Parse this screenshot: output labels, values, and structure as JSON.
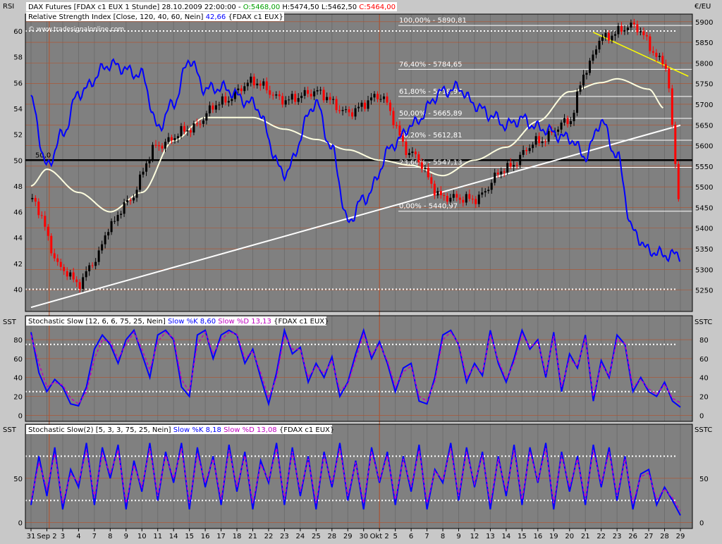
{
  "header": {
    "title_prefix": "DAX Futures [FDAX c1 EUX  1 Stunde] 28.10.2009 22:00:00 - ",
    "o": "O:5468,00",
    "h": "H:5474,50",
    "l": "L:5462,50",
    "c": "C:5464,00",
    "rsi_label": "Relative Strength Index [Close, 120, 40, 60, Nein]",
    "rsi_value": "42,66",
    "rsi_suffix": "{FDAX c1 EUX}",
    "watermark": "© www.tradesignalonline.com"
  },
  "panels": {
    "main": {
      "left_label": "RSI",
      "right_label": "€/EU"
    },
    "stoch1": {
      "left_label": "SST",
      "right_label": "SSTC",
      "title": "Stochastic Slow [12, 6, 6, 75, 25, Nein]",
      "k_label": "Slow %K 8,60",
      "d_label": "Slow %D 13,13",
      "suffix": "{FDAX c1 EUX}"
    },
    "stoch2": {
      "left_label": "SST",
      "right_label": "SSTC",
      "title": "Stochastic Slow(2) [5, 3, 3, 75, 25, Nein]",
      "k_label": "Slow %K 8,18",
      "d_label": "Slow %D 13,08",
      "suffix": "{FDAX c1 EUX}"
    }
  },
  "colors": {
    "plot_bg": "#808080",
    "frame_bg": "#c8c8c8",
    "up_candle": "#000000",
    "down_candle": "#ff0000",
    "rsi": "#0000ff",
    "moving_average": "#ffffe0",
    "trendline_up": "#ffffff",
    "trendline_down": "#ffff00",
    "fib": "#ffffff",
    "grid": "#b4502a",
    "stoch_k": "#0000ff",
    "stoch_d": "#c000c0",
    "o_color": "#00a000",
    "h_color": "#000000",
    "l_color": "#000000",
    "c_color": "#ff0000"
  },
  "chart_data": [
    {
      "type": "line",
      "panel": "main",
      "title": "DAX Futures [FDAX c1 EUX 1 Stunde] with RSI",
      "price_axis": {
        "ticks": [
          5250,
          5300,
          5350,
          5400,
          5450,
          5500,
          5550,
          5600,
          5650,
          5700,
          5750,
          5800,
          5850,
          5900
        ],
        "ylim": [
          5205,
          5915
        ]
      },
      "rsi_axis": {
        "ticks": [
          40,
          42,
          44,
          46,
          48,
          50,
          52,
          54,
          56,
          58,
          60
        ],
        "ylim": [
          38.5,
          61.2
        ]
      },
      "x_labels": [
        "31",
        "Sep 2",
        "3",
        "4",
        "7",
        "8",
        "9",
        "10",
        "11",
        "14",
        "15",
        "16",
        "17",
        "18",
        "21",
        "22",
        "23",
        "24",
        "25",
        "28",
        "29",
        "30",
        "Okt 2",
        "5",
        "6",
        "7",
        "8",
        "9",
        "12",
        "13",
        "14",
        "15",
        "16",
        "19",
        "20",
        "21",
        "22",
        "23",
        "26",
        "27",
        "28",
        "29"
      ],
      "rsi_level_label": "50,0",
      "fibonacci": [
        {
          "label": "100,00% - 5890,81",
          "price": 5890.81
        },
        {
          "label": "76,40% - 5784,65",
          "price": 5784.65
        },
        {
          "label": "61,80% - 5718,97",
          "price": 5718.97
        },
        {
          "label": "50,00% - 5665,89",
          "price": 5665.89
        },
        {
          "label": "38,20% - 5612,81",
          "price": 5612.81
        },
        {
          "label": "23,60% - 5547,13",
          "price": 5547.13
        },
        {
          "label": "0,00% - 5440,97",
          "price": 5440.97
        }
      ],
      "price_series": {
        "name": "FDAX c1 EUX",
        "x": [
          0,
          2,
          3,
          4,
          5,
          6,
          8,
          10,
          12,
          14,
          16,
          18,
          20,
          22,
          24,
          26,
          28,
          30,
          32,
          34,
          35,
          36,
          38,
          40,
          41
        ],
        "y": [
          5470,
          5300,
          5265,
          5320,
          5405,
          5460,
          5600,
          5640,
          5705,
          5755,
          5710,
          5730,
          5680,
          5720,
          5580,
          5475,
          5470,
          5545,
          5610,
          5660,
          5780,
          5860,
          5890,
          5800,
          5470
        ]
      },
      "rsi_series": {
        "name": "RSI",
        "x": [
          0,
          1,
          2,
          3,
          5,
          7,
          8,
          9,
          10,
          11,
          12,
          14,
          16,
          18,
          19,
          20,
          21,
          23,
          24,
          26,
          27,
          28,
          29,
          30,
          31,
          32,
          34,
          35,
          36,
          37,
          38,
          39,
          40,
          41
        ],
        "y": [
          54.6,
          49.5,
          52.0,
          55.2,
          57.4,
          56.6,
          52.5,
          54.4,
          57.8,
          55.5,
          55.6,
          54.4,
          49.0,
          54.4,
          50.8,
          45.2,
          47.0,
          51.3,
          52.7,
          55.3,
          55.6,
          54.3,
          53.5,
          52.7,
          53.2,
          52.5,
          51.7,
          50.3,
          53.0,
          50.3,
          44.5,
          43.0,
          42.66,
          42.66
        ]
      },
      "moving_average_series": {
        "x": [
          0,
          1,
          3,
          5,
          7,
          9,
          11,
          14,
          16,
          18,
          20,
          22,
          24,
          26,
          28,
          30,
          32,
          34,
          36,
          37,
          39,
          40
        ],
        "y": [
          48.0,
          49.3,
          47.5,
          46.0,
          47.5,
          51.5,
          53.3,
          53.3,
          52.4,
          51.6,
          50.8,
          50.0,
          49.6,
          48.8,
          50.0,
          51.0,
          53.0,
          55.3,
          56.0,
          56.3,
          55.5,
          54.0
        ]
      },
      "trendlines": [
        {
          "color": "trendline_up",
          "from": {
            "x": 0,
            "rsi": 38.6
          },
          "to": {
            "x": 41,
            "rsi": 52.7
          }
        },
        {
          "color": "trendline_down",
          "from": {
            "x": 35.5,
            "rsi": 59.9
          },
          "to": {
            "x": 41.5,
            "rsi": 56.5
          }
        }
      ]
    },
    {
      "type": "line",
      "panel": "stoch1",
      "title": "Stochastic Slow [12, 6, 6, 75, 25, Nein]",
      "y_ticks": [
        0,
        20,
        40,
        60,
        80
      ],
      "levels": [
        75,
        25
      ],
      "ylim": [
        -5,
        95
      ],
      "series": [
        {
          "name": "Slow %K",
          "color": "stoch_k",
          "x": [
            0,
            0.5,
            1,
            1.5,
            2,
            2.5,
            3,
            3.5,
            4,
            4.5,
            5,
            5.5,
            6,
            6.5,
            7,
            7.5,
            8,
            8.5,
            9,
            9.5,
            10,
            10.5,
            11,
            11.5,
            12,
            12.5,
            13,
            13.5,
            14,
            14.5,
            15,
            15.5,
            16,
            16.5,
            17,
            17.5,
            18,
            18.5,
            19,
            19.5,
            20,
            20.5,
            21,
            21.5,
            22,
            22.5,
            23,
            23.5,
            24,
            24.5,
            25,
            25.5,
            26,
            26.5,
            27,
            27.5,
            28,
            28.5,
            29,
            29.5,
            30,
            30.5,
            31,
            31.5,
            32,
            32.5,
            33,
            33.5,
            34,
            34.5,
            35,
            35.5,
            36,
            36.5,
            37,
            37.5,
            38,
            38.5,
            39,
            39.5,
            40,
            40.5,
            41
          ],
          "y": [
            88,
            45,
            25,
            38,
            30,
            12,
            10,
            30,
            70,
            85,
            75,
            55,
            80,
            90,
            65,
            40,
            85,
            90,
            80,
            30,
            20,
            85,
            90,
            60,
            85,
            90,
            85,
            55,
            70,
            40,
            12,
            45,
            90,
            65,
            72,
            35,
            55,
            40,
            62,
            20,
            35,
            65,
            90,
            60,
            78,
            55,
            25,
            50,
            55,
            15,
            12,
            40,
            85,
            90,
            75,
            35,
            55,
            42,
            90,
            55,
            35,
            60,
            90,
            70,
            80,
            40,
            88,
            25,
            65,
            50,
            85,
            15,
            58,
            40,
            85,
            75,
            25,
            40,
            25,
            20,
            35,
            15,
            8.6
          ]
        },
        {
          "name": "Slow %D",
          "color": "stoch_d",
          "x": [
            0,
            0.5,
            1,
            1.5,
            2,
            2.5,
            3,
            3.5,
            4,
            4.5,
            5,
            5.5,
            6,
            6.5,
            7,
            7.5,
            8,
            8.5,
            9,
            9.5,
            10,
            10.5,
            11,
            11.5,
            12,
            12.5,
            13,
            13.5,
            14,
            14.5,
            15,
            15.5,
            16,
            16.5,
            17,
            17.5,
            18,
            18.5,
            19,
            19.5,
            20,
            20.5,
            21,
            21.5,
            22,
            22.5,
            23,
            23.5,
            24,
            24.5,
            25,
            25.5,
            26,
            26.5,
            27,
            27.5,
            28,
            28.5,
            29,
            29.5,
            30,
            30.5,
            31,
            31.5,
            32,
            32.5,
            33,
            33.5,
            34,
            34.5,
            35,
            35.5,
            36,
            36.5,
            37,
            37.5,
            38,
            38.5,
            39,
            39.5,
            40,
            40.5,
            41
          ],
          "y": [
            85,
            55,
            30,
            35,
            32,
            18,
            12,
            25,
            60,
            80,
            78,
            60,
            75,
            88,
            70,
            48,
            78,
            88,
            82,
            38,
            25,
            75,
            88,
            65,
            80,
            88,
            86,
            60,
            68,
            45,
            18,
            40,
            85,
            70,
            70,
            40,
            52,
            44,
            58,
            26,
            33,
            60,
            86,
            64,
            75,
            58,
            30,
            46,
            52,
            20,
            15,
            36,
            80,
            88,
            76,
            40,
            52,
            45,
            86,
            58,
            38,
            56,
            86,
            72,
            78,
            44,
            84,
            30,
            60,
            52,
            82,
            20,
            54,
            42,
            80,
            76,
            30,
            38,
            28,
            22,
            33,
            18,
            13.13
          ]
        }
      ]
    },
    {
      "type": "line",
      "panel": "stoch2",
      "title": "Stochastic Slow(2) [5, 3, 3, 75, 25, Nein]",
      "y_ticks": [
        0,
        50
      ],
      "levels": [
        75,
        25
      ],
      "ylim": [
        -5,
        100
      ],
      "series": [
        {
          "name": "Slow %K",
          "color": "stoch_k",
          "x": [
            0,
            0.5,
            1,
            1.5,
            2,
            2.5,
            3,
            3.5,
            4,
            4.5,
            5,
            5.5,
            6,
            6.5,
            7,
            7.5,
            8,
            8.5,
            9,
            9.5,
            10,
            10.5,
            11,
            11.5,
            12,
            12.5,
            13,
            13.5,
            14,
            14.5,
            15,
            15.5,
            16,
            16.5,
            17,
            17.5,
            18,
            18.5,
            19,
            19.5,
            20,
            20.5,
            21,
            21.5,
            22,
            22.5,
            23,
            23.5,
            24,
            24.5,
            25,
            25.5,
            26,
            26.5,
            27,
            27.5,
            28,
            28.5,
            29,
            29.5,
            30,
            30.5,
            31,
            31.5,
            32,
            32.5,
            33,
            33.5,
            34,
            34.5,
            35,
            35.5,
            36,
            36.5,
            37,
            37.5,
            38,
            38.5,
            39,
            39.5,
            40,
            40.5,
            41
          ],
          "y": [
            20,
            75,
            30,
            85,
            15,
            60,
            40,
            90,
            20,
            85,
            50,
            88,
            15,
            70,
            35,
            90,
            25,
            80,
            45,
            90,
            15,
            85,
            40,
            75,
            20,
            88,
            35,
            80,
            15,
            70,
            45,
            90,
            20,
            85,
            30,
            75,
            15,
            80,
            40,
            90,
            25,
            70,
            15,
            85,
            45,
            80,
            20,
            75,
            35,
            88,
            15,
            60,
            45,
            90,
            25,
            85,
            40,
            80,
            15,
            75,
            30,
            88,
            20,
            85,
            45,
            90,
            15,
            80,
            35,
            75,
            20,
            88,
            40,
            85,
            25,
            75,
            15,
            55,
            60,
            20,
            40,
            25,
            8.18
          ]
        },
        {
          "name": "Slow %D",
          "color": "stoch_d",
          "x": [
            0,
            0.5,
            1,
            1.5,
            2,
            2.5,
            3,
            3.5,
            4,
            4.5,
            5,
            5.5,
            6,
            6.5,
            7,
            7.5,
            8,
            8.5,
            9,
            9.5,
            10,
            10.5,
            11,
            11.5,
            12,
            12.5,
            13,
            13.5,
            14,
            14.5,
            15,
            15.5,
            16,
            16.5,
            17,
            17.5,
            18,
            18.5,
            19,
            19.5,
            20,
            20.5,
            21,
            21.5,
            22,
            22.5,
            23,
            23.5,
            24,
            24.5,
            25,
            25.5,
            26,
            26.5,
            27,
            27.5,
            28,
            28.5,
            29,
            29.5,
            30,
            30.5,
            31,
            31.5,
            32,
            32.5,
            33,
            33.5,
            34,
            34.5,
            35,
            35.5,
            36,
            36.5,
            37,
            37.5,
            38,
            38.5,
            39,
            39.5,
            40,
            40.5,
            41
          ],
          "y": [
            25,
            68,
            38,
            78,
            22,
            55,
            45,
            82,
            28,
            78,
            55,
            82,
            22,
            65,
            40,
            84,
            30,
            76,
            50,
            84,
            22,
            78,
            45,
            72,
            26,
            82,
            40,
            76,
            22,
            66,
            48,
            84,
            26,
            80,
            35,
            72,
            22,
            76,
            44,
            84,
            30,
            68,
            22,
            80,
            48,
            76,
            26,
            72,
            40,
            82,
            22,
            58,
            48,
            84,
            30,
            80,
            44,
            76,
            22,
            72,
            35,
            82,
            26,
            80,
            48,
            84,
            22,
            76,
            40,
            72,
            26,
            82,
            44,
            80,
            30,
            72,
            22,
            52,
            56,
            26,
            38,
            28,
            13.08
          ]
        }
      ]
    }
  ]
}
